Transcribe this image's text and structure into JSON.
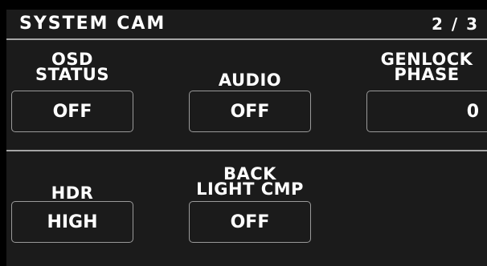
{
  "header": {
    "title": "SYSTEM CAM",
    "page": "2 / 3"
  },
  "row1": [
    {
      "label_lines": [
        "OSD",
        "STATUS"
      ],
      "value": "OFF"
    },
    {
      "label_lines": [
        "AUDIO"
      ],
      "value": "OFF"
    },
    {
      "label_lines": [
        "GENLOCK",
        "PHASE"
      ],
      "value": "0"
    }
  ],
  "row2": [
    {
      "label_lines": [
        "HDR"
      ],
      "value": "HIGH"
    },
    {
      "label_lines": [
        "BACK",
        "LIGHT CMP"
      ],
      "value": "OFF"
    }
  ]
}
